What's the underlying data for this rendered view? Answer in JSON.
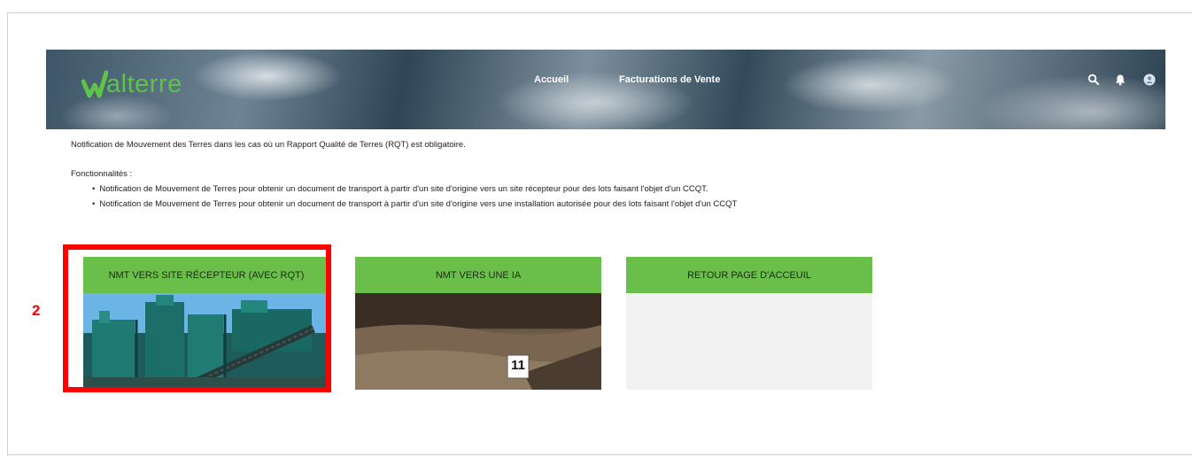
{
  "header": {
    "logo_text": "alterre",
    "nav": [
      "Accueil",
      "Facturations de Vente"
    ],
    "icons": [
      "search-icon",
      "bell-icon",
      "user-icon"
    ]
  },
  "content": {
    "description": "Notification de Mouvement des Terres dans les cas où un Rapport Qualité de Terres (RQT) est obligatoire.",
    "features_title": "Fonctionnalités :",
    "features": [
      "Notification de Mouvement de Terres pour obtenir un document de transport à partir d'un site d'origine vers un site récepteur pour des lots faisant l'objet d'un CCQT.",
      "Notification de Mouvement de Terres pour obtenir un document de transport à partir d'un site d'origine vers une installation autorisée pour des lots faisant l'objet d'un CCQT"
    ]
  },
  "cards": [
    {
      "title": "NMT VERS SITE RÉCEPTEUR (AVEC RQT)"
    },
    {
      "title": "NMT VERS UNE IA",
      "image_label": "11"
    },
    {
      "title": "RETOUR PAGE D'ACCEUIL"
    }
  ],
  "annotation": {
    "step": "2",
    "color": "#ff0000"
  },
  "colors": {
    "brand_green": "#6abf4b",
    "logo_green": "#5fc24a"
  }
}
